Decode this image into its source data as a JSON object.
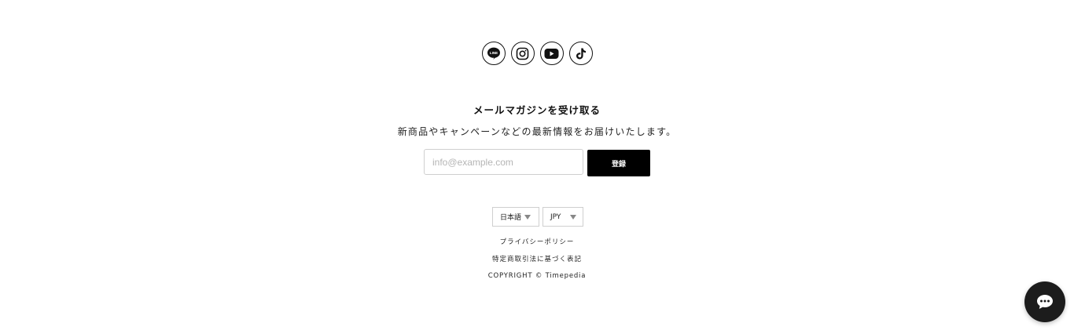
{
  "social": {
    "icons": [
      "line-icon",
      "instagram-icon",
      "youtube-icon",
      "tiktok-icon"
    ],
    "line_label": "LINE"
  },
  "newsletter": {
    "title": "メールマガジンを受け取る",
    "description": "新商品やキャンペーンなどの最新情報をお届けいたします。",
    "email_placeholder": "info@example.com",
    "submit_label": "登録"
  },
  "selectors": {
    "language": "日本語",
    "currency": "JPY"
  },
  "links": {
    "privacy": "プライバシーポリシー",
    "legal": "特定商取引法に基づく表記"
  },
  "copyright": "COPYRIGHT © Timepedia",
  "chat": {
    "icon": "chat-bubble-icon"
  },
  "colors": {
    "primary": "#000000",
    "border": "#cfcfcf",
    "chat_bg": "#1c1c1c"
  }
}
